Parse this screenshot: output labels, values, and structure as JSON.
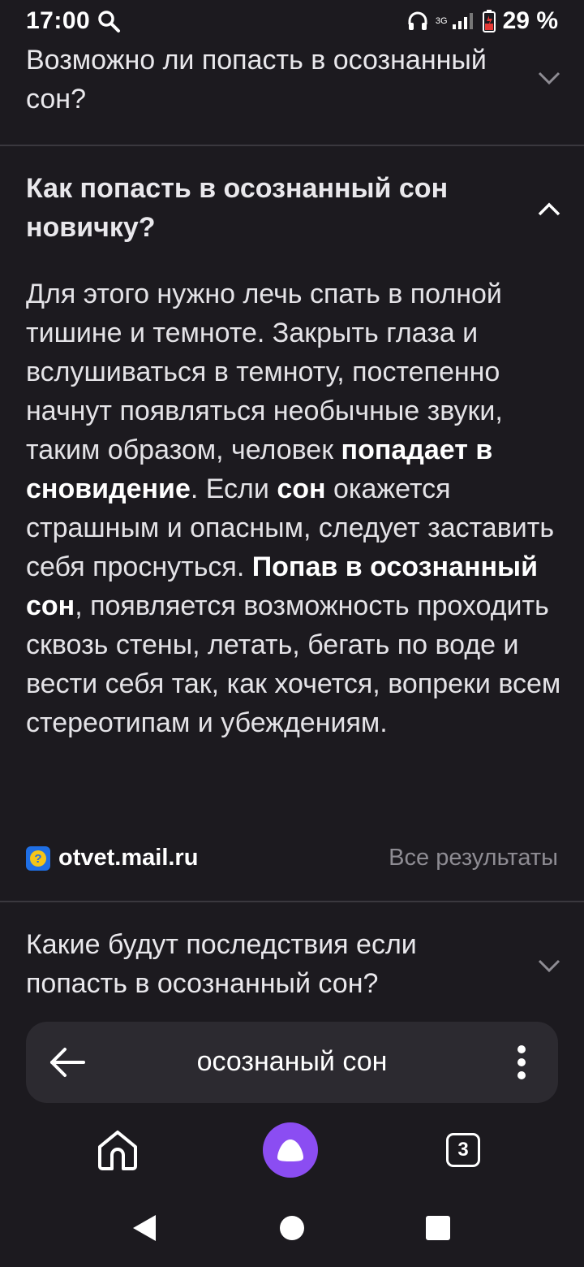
{
  "status_bar": {
    "time": "17:00",
    "network_label": "3G",
    "battery": "29 %",
    "icons": [
      "search-icon",
      "headphones-icon",
      "signal-icon",
      "battery-icon"
    ]
  },
  "faq": [
    {
      "question": "Возможно ли попасть в осознанный сон?",
      "expanded": false
    },
    {
      "question": "Как попасть в осознанный сон новичку?",
      "expanded": true
    },
    {
      "question": "Какие будут последствия если попасть в осознанный сон?",
      "expanded": false
    }
  ],
  "answer": {
    "p1": "Для этого нужно лечь спать в полной тишине и темноте. Закрыть глаза и вслушиваться в темноту, постепенно начнут появляться необычные звуки, таким образом, человек ",
    "b1": "попадает в сновидение",
    "p2": ". Если ",
    "b2": "сон",
    "p3": " окажется страшным и опасным, следует заставить себя проснуться. ",
    "b3": "Попав в осознанный сон",
    "p4": ", появляется возможность проходить сквозь стены, летать, бегать по воде и вести себя так, как хочется, вопреки всем стереотипам и убеждениям."
  },
  "source": {
    "name": "otvet.mail.ru",
    "icon": "question-mark-icon",
    "all_results_label": "Все результаты"
  },
  "search_bar": {
    "query": "осознаный сон"
  },
  "bottom_nav": {
    "tabs_count": "3"
  },
  "colors": {
    "background": "#1c1a1f",
    "accent": "#8b4df2",
    "source_icon": "#1f6fe5"
  }
}
